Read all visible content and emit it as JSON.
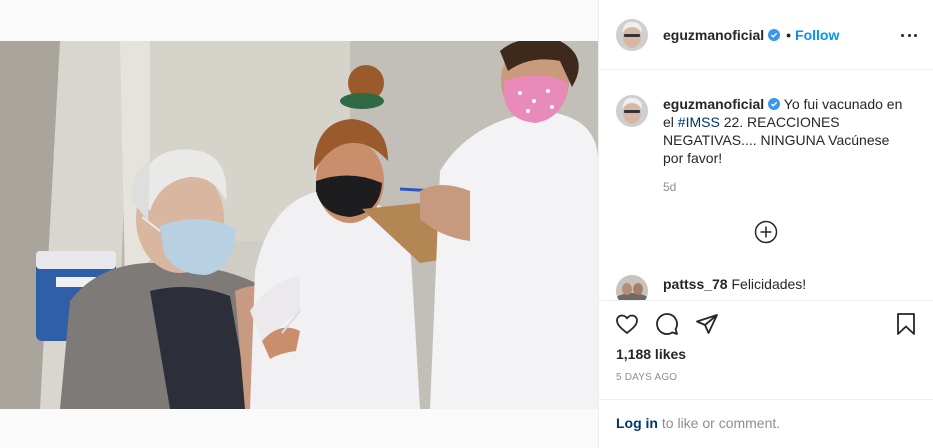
{
  "post": {
    "username": "eguzmanoficial",
    "follow_label": "Follow",
    "separator": "•",
    "caption": {
      "text_before": " Yo fui vacunado en el ",
      "hashtag": "#IMSS",
      "text_after": " 22. REACCIONES NEGATIVAS.... NINGUNA Vacúnese por favor!"
    },
    "age": "5d",
    "comments": [
      {
        "username": "pattss_78",
        "text": " Felicidades!"
      }
    ],
    "likes": "1,188 likes",
    "date": "5 DAYS AGO",
    "login": {
      "link": "Log in",
      "rest": " to like or comment."
    }
  },
  "icons": {
    "verified": "verified-badge-icon",
    "more": "more-options-icon",
    "load_more": "load-more-comments-icon",
    "like": "heart-icon",
    "comment": "comment-icon",
    "share": "share-icon",
    "save": "bookmark-icon"
  },
  "colors": {
    "accent": "#0095f6",
    "link": "#00376b",
    "muted": "#8e8e8e",
    "mask_pink": "#e88bb8"
  }
}
